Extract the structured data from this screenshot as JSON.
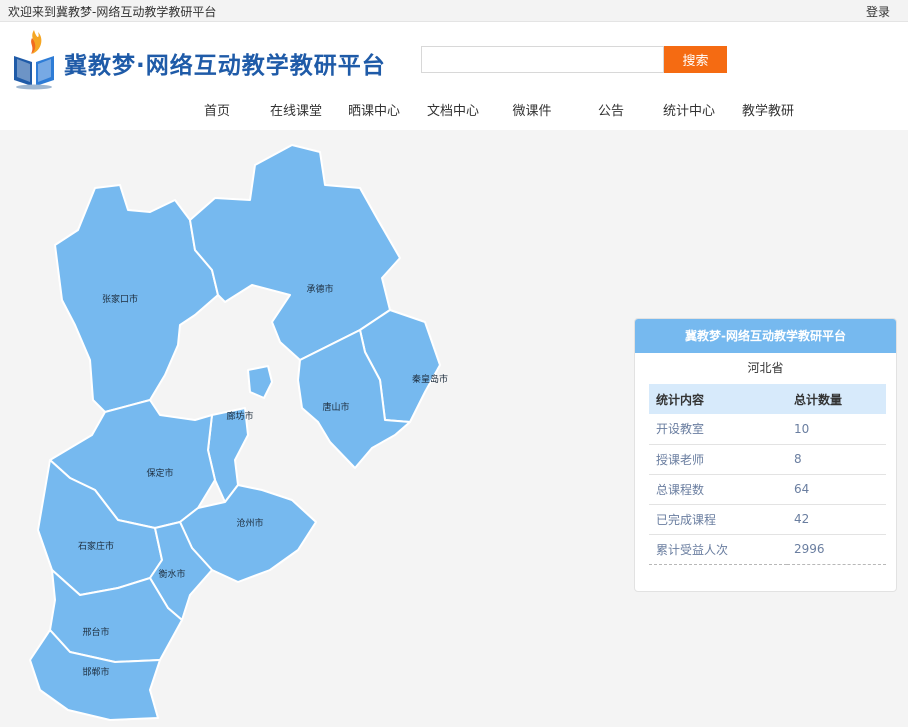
{
  "topbar": {
    "welcome": "欢迎来到冀教梦-网络互动教学教研平台",
    "login": "登录"
  },
  "logo": {
    "text": "冀教梦·网络互动教学教研平台"
  },
  "search": {
    "value": "",
    "button": "搜索"
  },
  "nav": {
    "items": [
      {
        "label": "首页"
      },
      {
        "label": "在线课堂"
      },
      {
        "label": "晒课中心"
      },
      {
        "label": "文档中心"
      },
      {
        "label": "微课件"
      },
      {
        "label": "公告"
      },
      {
        "label": "统计中心"
      },
      {
        "label": "教学教研"
      }
    ]
  },
  "map": {
    "region_color": "#76b9ef",
    "cities": [
      {
        "name": "张家口市"
      },
      {
        "name": "承德市"
      },
      {
        "name": "秦皇岛市"
      },
      {
        "name": "唐山市"
      },
      {
        "name": "廊坊市"
      },
      {
        "name": "保定市"
      },
      {
        "name": "沧州市"
      },
      {
        "name": "石家庄市"
      },
      {
        "name": "衡水市"
      },
      {
        "name": "邢台市"
      },
      {
        "name": "邯郸市"
      }
    ]
  },
  "panel": {
    "title": "冀教梦-网络互动教学教研平台",
    "subtitle": "河北省",
    "headers": [
      "统计内容",
      "总计数量"
    ],
    "rows": [
      {
        "label": "开设教室",
        "value": "10"
      },
      {
        "label": "授课老师",
        "value": "8"
      },
      {
        "label": "总课程数",
        "value": "64"
      },
      {
        "label": "已完成课程",
        "value": "42"
      },
      {
        "label": "累计受益人次",
        "value": "2996"
      }
    ]
  },
  "colors": {
    "accent": "#76b9ef",
    "search_button": "#f56b12",
    "logo_text": "#1f5ba8",
    "table_header": "#d7eafb"
  }
}
